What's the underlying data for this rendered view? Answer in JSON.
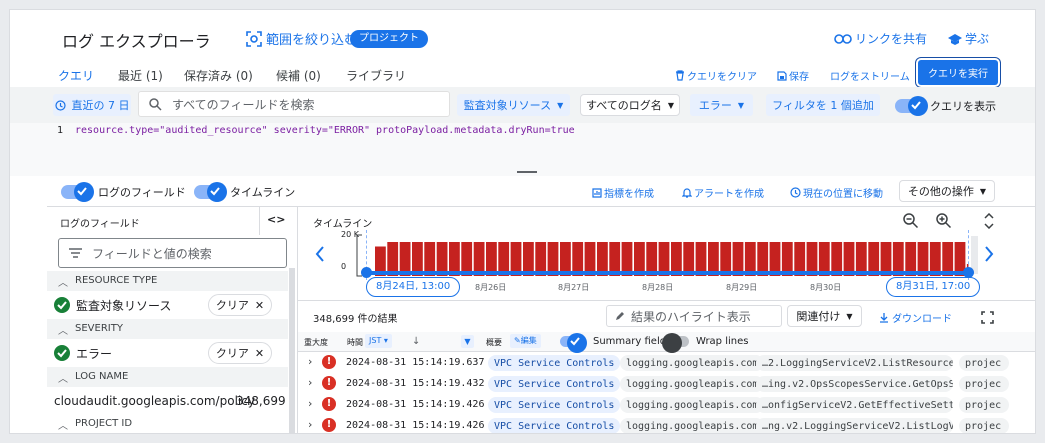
{
  "header": {
    "title": "ログ エクスプローラ",
    "scope_label": "範囲を絞り込む",
    "scope_badge": "プロジェクト",
    "share_link": "リンクを共有",
    "learn": "学ぶ"
  },
  "tabs": [
    {
      "label": "クエリ",
      "active": true
    },
    {
      "label": "最近 (1)"
    },
    {
      "label": "保存済み (0)"
    },
    {
      "label": "候補 (0)"
    },
    {
      "label": "ライブラリ"
    }
  ],
  "query_actions": {
    "clear": "クエリをクリア",
    "save": "保存",
    "stream": "ログをストリーム",
    "run": "クエリを実行"
  },
  "filters": {
    "time_range": "直近の 7 日",
    "search_placeholder": "すべてのフィールドを検索",
    "resource": "監査対象リソース",
    "log_names": "すべてのログ名",
    "severity": "エラー",
    "add_filter": "フィルタを 1 個追加",
    "show_query": "クエリを表示"
  },
  "editor": {
    "line_number": "1",
    "query_text": "resource.type=\"audited_resource\" severity=\"ERROR\" protoPayload.metadata.dryRun=true"
  },
  "panels": {
    "log_fields_toggle": "ログのフィールド",
    "timeline_toggle": "タイムライン",
    "create_metric": "指標を作成",
    "create_alert": "アラートを作成",
    "jump_now": "現在の位置に移動",
    "more_actions": "その他の操作"
  },
  "sidebar": {
    "title": "ログのフィールド",
    "search_placeholder": "フィールドと値の検索",
    "sections": [
      {
        "title": "RESOURCE TYPE",
        "value": "監査対象リソース",
        "clear": "クリア"
      },
      {
        "title": "SEVERITY",
        "value": "エラー",
        "clear": "クリア"
      }
    ],
    "log_name_title": "LOG NAME",
    "log_name_value": "cloudaudit.googleapis.com/policy",
    "log_name_count": "348,699",
    "project_id_title": "PROJECT ID"
  },
  "timeline": {
    "title": "タイムライン",
    "y_max": "20 K",
    "y_min": "0",
    "start_label": "8月24日, 13:00",
    "end_label": "8月31日, 17:00",
    "ticks": [
      "8月26日",
      "8月27日",
      "8月28日",
      "8月29日",
      "8月30日"
    ],
    "bar_color": "#c5221f"
  },
  "chart_data": {
    "type": "bar",
    "values": [
      0.45,
      0.8,
      0.85,
      0.85,
      0.85,
      0.85,
      0.85,
      0.85,
      0.85,
      0.85,
      0.85,
      0.85,
      0.85,
      0.85,
      0.85,
      0.85,
      0.85,
      0.85,
      0.85,
      0.85,
      0.85,
      0.85,
      0.85,
      0.85,
      0.85,
      0.85,
      0.85,
      0.85,
      0.85,
      0.85,
      0.85,
      0.85,
      0.85,
      0.85,
      0.85,
      0.85,
      0.85,
      0.85,
      0.85,
      0.85,
      0.85,
      0.85,
      0.85,
      0.85,
      0.85,
      0.85,
      0.85,
      0.85,
      0.85,
      0.85,
      0.85,
      0.85,
      0.85,
      0.85,
      0.85,
      0.85,
      0.85,
      0.85,
      0.85,
      0.85,
      0.85,
      0.85,
      0.85,
      0.85,
      0.85,
      0.85,
      0.85,
      0.85,
      0.85,
      0.85,
      0.85,
      0.85,
      0.85,
      0.85,
      0.85,
      0.85,
      0.85,
      0.85,
      0.85,
      0.85,
      0.85,
      0.85,
      0.85,
      0.85,
      0.85,
      0.85,
      0.85,
      0.85,
      0.85,
      0.85,
      0.85,
      0.85,
      0.85,
      0.85,
      0.85,
      0.85,
      0.85,
      0.85,
      0.85,
      0.85,
      0.85,
      0.85,
      0.85,
      0.85,
      0.85,
      0.85,
      0.85,
      0.85,
      0.85,
      0.85,
      0.85,
      0.85,
      0.85,
      0.85,
      0.85,
      0.85,
      0.85,
      0.85,
      0.85,
      0.85,
      0.85,
      0.85,
      0.85,
      0.85,
      0.85,
      0.85,
      0.85,
      0.85,
      0.85,
      0.85,
      0.85,
      0.85,
      0.85,
      0.85,
      0.85,
      0.85,
      0.85,
      0.85,
      0.85,
      0.85,
      0.85,
      0.85,
      0.85,
      0.85,
      0.85,
      0.85,
      0.85,
      0.85,
      0.85,
      0.85,
      0.85,
      0.85,
      0.85,
      0.85,
      0.85,
      0.85,
      0.85,
      0.85,
      0.85,
      0.85,
      0.85,
      0.85,
      0.85,
      0.85,
      0.85,
      0.85,
      0.85,
      0.85,
      0.85,
      0.85,
      0.85,
      0.85,
      0.85,
      0.85,
      0.85,
      0.85,
      0.85,
      0.85,
      0.85,
      0.85,
      0.85,
      0.85,
      0.85,
      0.85,
      0.85,
      0.85,
      0.85,
      0.85,
      0.85,
      0.85,
      0.85,
      0.85,
      0.3
    ],
    "ylim": [
      0,
      20000
    ]
  },
  "results": {
    "count": "348,699 件の結果",
    "highlight_placeholder": "結果のハイライト表示",
    "correlate": "関連付け",
    "download": "ダウンロード",
    "col_severity": "重大度",
    "col_time": "時間",
    "tz": "JST",
    "col_summary": "概要",
    "edit": "編集",
    "summary_fields": "Summary fields",
    "wrap_lines": "Wrap lines",
    "rows": [
      {
        "time": "2024-08-31 15:14:19.637",
        "c1": "VPC Service Controls",
        "c2": "logging.googleapis.com",
        "c3": "…2.LoggingServiceV2.ListResourceKeys",
        "c4": "projec"
      },
      {
        "time": "2024-08-31 15:14:19.432",
        "c1": "VPC Service Controls",
        "c2": "logging.googleapis.com",
        "c3": "…ing.v2.OpsScopesService.GetOpsScope",
        "c4": "projec"
      },
      {
        "time": "2024-08-31 15:14:19.426",
        "c1": "VPC Service Controls",
        "c2": "logging.googleapis.com",
        "c3": "…onfigServiceV2.GetEffectiveSettings",
        "c4": "projec"
      },
      {
        "time": "2024-08-31 15:14:19.426",
        "c1": "VPC Service Controls",
        "c2": "logging.googleapis.com",
        "c3": "…ng.v2.LoggingServiceV2.ListLogViews",
        "c4": "projec"
      }
    ]
  }
}
